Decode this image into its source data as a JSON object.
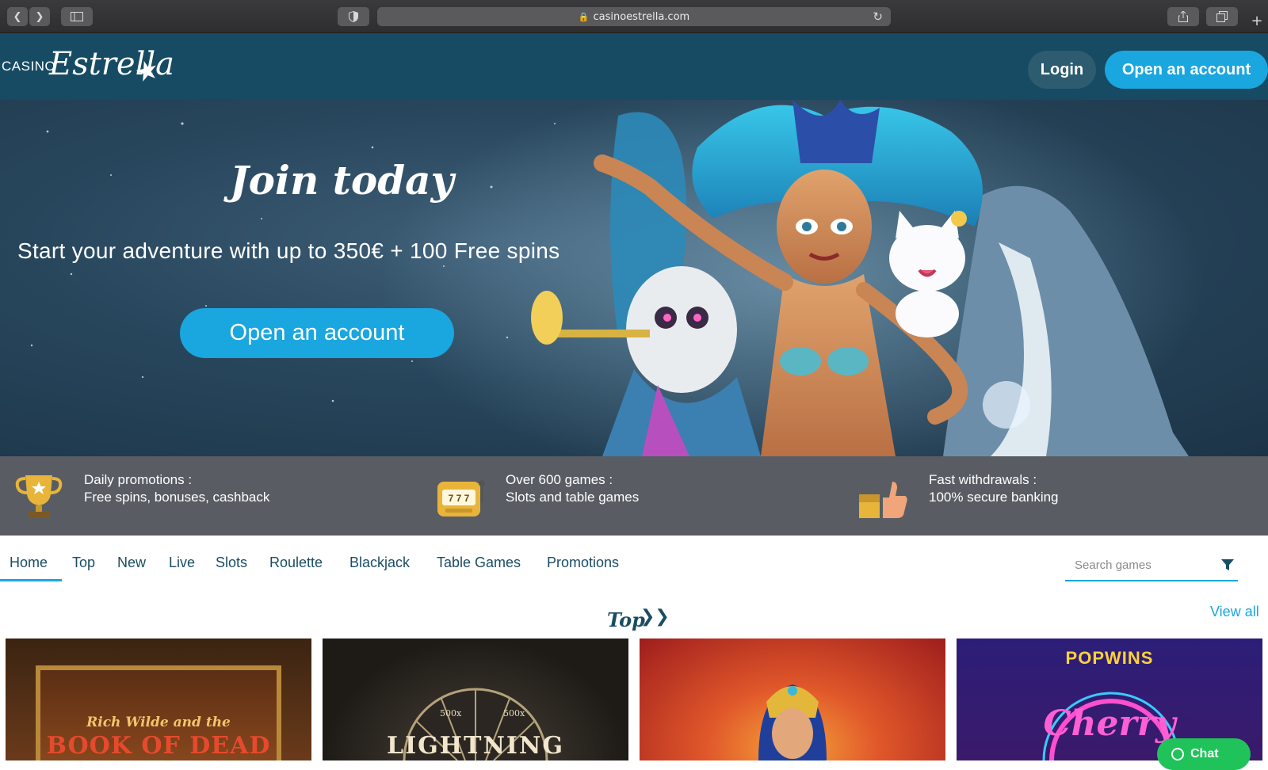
{
  "browser": {
    "url": "casinoestrella.com"
  },
  "header": {
    "logo_casino": "CASINO",
    "logo_estrella": "Estrella",
    "login_label": "Login",
    "open_account_label": "Open an account"
  },
  "hero": {
    "title": "Join today",
    "subtitle": "Start your adventure with up to 350€ + 100 Free spins",
    "cta_label": "Open an account"
  },
  "features": [
    {
      "line1": "Daily promotions :",
      "line2": "Free spins, bonuses, cashback",
      "icon": "trophy-icon"
    },
    {
      "line1": "Over 600 games :",
      "line2": "Slots and table games",
      "icon": "slot-machine-icon"
    },
    {
      "line1": "Fast withdrawals :",
      "line2": "100% secure banking",
      "icon": "thumbs-up-icon"
    }
  ],
  "nav": {
    "tabs": [
      "Home",
      "Top",
      "New",
      "Live",
      "Slots",
      "Roulette",
      "Blackjack",
      "Table Games",
      "Promotions"
    ],
    "active": "Home",
    "search_placeholder": "Search games"
  },
  "section": {
    "title": "Top",
    "view_all": "View all"
  },
  "games": [
    {
      "title": "Rich Wilde and the Book of Dead"
    },
    {
      "title": "Lightning"
    },
    {
      "title": ""
    },
    {
      "title": "Cherry"
    }
  ],
  "games_art_text": {
    "book_small": "Rich Wilde and the",
    "book_big": "BOOK OF DEAD",
    "lightning_badges": [
      "500x",
      "500x"
    ],
    "lightning_word": "LIGHTNING",
    "popwins": "POPWINS"
  },
  "chat": {
    "label": "Chat"
  },
  "colors": {
    "header_bg": "#164b63",
    "accent": "#1aa6df",
    "text_dark": "#1a4d63",
    "chat": "#20c35a"
  }
}
